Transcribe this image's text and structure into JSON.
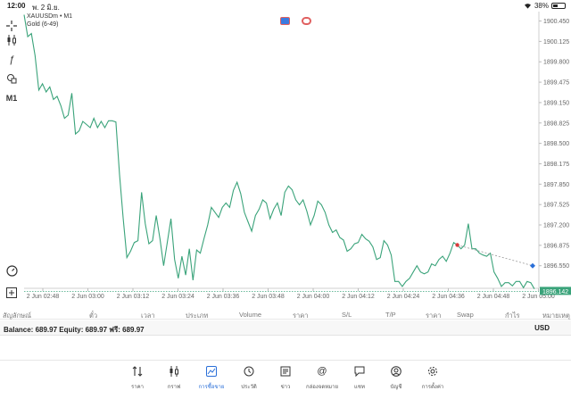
{
  "status": {
    "time": "12:00",
    "date": "พ. 2 มิ.ย.",
    "battery": "38%"
  },
  "chart_header": {
    "symbol": "XAUUSDm • M1",
    "indicator": "Gold (6-49)"
  },
  "toolbar": {
    "crosshair_icon": "+",
    "candles_icon": "candles-icon",
    "indicator_icon": "ƒ",
    "objects_icon": "shapes-icon",
    "timeframe": "M1",
    "gauge_icon": "gauge-icon",
    "add_icon": "add-icon"
  },
  "chart_data": {
    "type": "line",
    "title": "",
    "xlabel": "",
    "ylabel": "",
    "x_ticks": [
      "2 Jun 02:48",
      "2 Jun 03:00",
      "2 Jun 03:12",
      "2 Jun 03:24",
      "2 Jun 03:36",
      "2 Jun 03:48",
      "2 Jun 04:00",
      "2 Jun 04:12",
      "2 Jun 04:24",
      "2 Jun 04:36",
      "2 Jun 04:48",
      "2 Jun 05:00"
    ],
    "y_ticks": [
      "1900.450",
      "1900.125",
      "1899.800",
      "1899.475",
      "1899.150",
      "1898.825",
      "1898.500",
      "1898.175",
      "1897.850",
      "1897.525",
      "1897.200",
      "1896.875",
      "1896.550"
    ],
    "ylim": [
      1896.19,
      1900.6
    ],
    "line_color": "#3aa37a",
    "current_price": "1896.142",
    "current_price_value": 1896.142,
    "series": [
      {
        "values": [
          1900.55,
          1900.2,
          1900.25,
          1899.9,
          1899.35,
          1899.45,
          1899.32,
          1899.4,
          1899.2,
          1899.25,
          1899.1,
          1898.9,
          1898.95,
          1899.3,
          1898.65,
          1898.7,
          1898.85,
          1898.8,
          1898.75,
          1898.9,
          1898.75,
          1898.85,
          1898.75,
          1898.86,
          1898.86,
          1898.84,
          1898.0,
          1897.3,
          1896.68,
          1896.78,
          1896.92,
          1896.95,
          1897.72,
          1897.22,
          1896.9,
          1896.95,
          1897.35,
          1896.98,
          1896.55,
          1896.92,
          1897.3,
          1896.65,
          1896.35,
          1896.7,
          1896.4,
          1896.82,
          1896.32,
          1896.8,
          1896.75,
          1896.98,
          1897.2,
          1897.48,
          1897.4,
          1897.32,
          1897.48,
          1897.55,
          1897.48,
          1897.75,
          1897.88,
          1897.7,
          1897.4,
          1897.25,
          1897.1,
          1897.35,
          1897.45,
          1897.6,
          1897.55,
          1897.3,
          1897.45,
          1897.55,
          1897.35,
          1897.72,
          1897.82,
          1897.76,
          1897.6,
          1897.52,
          1897.6,
          1897.42,
          1897.2,
          1897.35,
          1897.58,
          1897.52,
          1897.4,
          1897.2,
          1897.08,
          1897.12,
          1897.0,
          1896.96,
          1896.78,
          1896.82,
          1896.9,
          1896.92,
          1897.05,
          1896.98,
          1896.94,
          1896.85,
          1896.65,
          1896.68,
          1896.95,
          1896.88,
          1896.72,
          1896.3,
          1896.3,
          1896.22,
          1896.3,
          1896.35,
          1896.45,
          1896.55,
          1896.45,
          1896.42,
          1896.45,
          1896.58,
          1896.55,
          1896.65,
          1896.7,
          1896.62,
          1896.75,
          1896.92,
          1896.88,
          1896.82,
          1896.88,
          1897.22,
          1896.82,
          1896.82,
          1896.75,
          1896.72,
          1896.7,
          1896.75,
          1896.45,
          1896.35,
          1896.22,
          1896.28,
          1896.28,
          1896.23,
          1896.3,
          1896.3,
          1896.2,
          1896.3,
          1896.28,
          1896.18
        ]
      }
    ],
    "order_marker": {
      "from_index": 118,
      "from_value": 1896.88,
      "to_value": 1896.55
    }
  },
  "table_headers": [
    "สัญลักษณ์",
    "ตั๋ว",
    "เวลา",
    "ประเภท",
    "Volume",
    "ราคา",
    "S/L",
    "T/P",
    "ราคา",
    "Swap",
    "กำไร",
    "หมายเหตุ"
  ],
  "balance": {
    "text": "Balance: 689.97 Equity: 689.97 ฟรี: 689.97",
    "currency": "USD"
  },
  "nav": [
    {
      "label": "ราคา",
      "icon": "⇅"
    },
    {
      "label": "กราฟ",
      "icon": "candles-icon"
    },
    {
      "label": "การซื้อขาย",
      "icon": "trade-chart-icon"
    },
    {
      "label": "ประวัติ",
      "icon": "history-icon"
    },
    {
      "label": "ข่าว",
      "icon": "news-icon"
    },
    {
      "label": "กล่องจดหมาย",
      "icon": "@"
    },
    {
      "label": "แชท",
      "icon": "chat-icon"
    },
    {
      "label": "บัญชี",
      "icon": "account-icon"
    },
    {
      "label": "การตั้งค่า",
      "icon": "gear-icon"
    }
  ]
}
